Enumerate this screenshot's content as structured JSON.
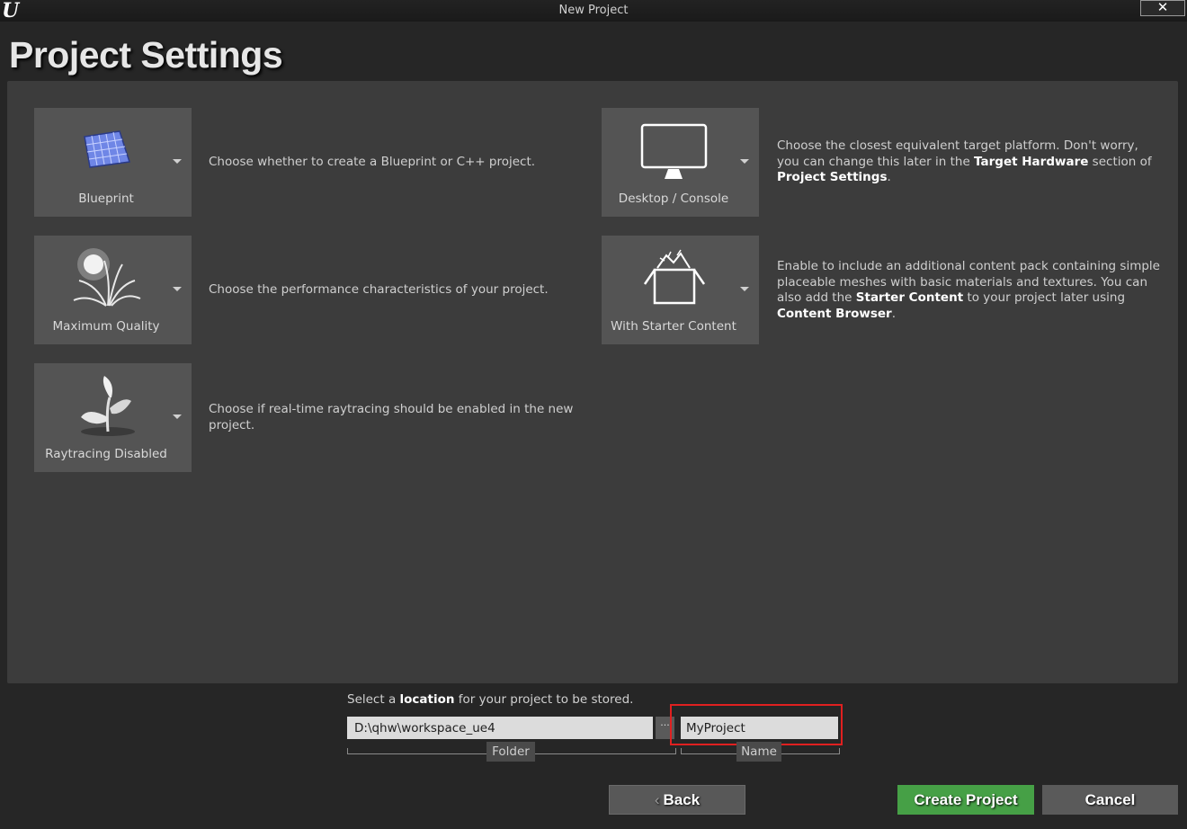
{
  "window": {
    "title": "New Project",
    "logo": "U",
    "close_glyph": "✕"
  },
  "page_title": "Project Settings",
  "tiles": [
    {
      "label": "Blueprint",
      "icon": "blueprint-icon",
      "description": "Choose whether to create a Blueprint or C++ project."
    },
    {
      "label": "Maximum Quality",
      "icon": "quality-plant-icon",
      "description": "Choose the performance characteristics of your project."
    },
    {
      "label": "Raytracing Disabled",
      "icon": "raytracing-leaf-icon",
      "description": "Choose if real-time raytracing should be enabled in the new project."
    },
    {
      "label": "Desktop / Console",
      "icon": "monitor-icon",
      "description_parts": [
        "Choose the closest equivalent target platform. Don't worry, you can change this later in the ",
        "Target Hardware",
        " section of ",
        "Project Settings",
        "."
      ]
    },
    {
      "label": "With Starter Content",
      "icon": "starter-content-box-icon",
      "description_parts": [
        "Enable to include an additional content pack containing simple placeable meshes with basic materials and textures. You can also add the ",
        "Starter Content",
        " to your project later using ",
        "Content Browser",
        "."
      ]
    }
  ],
  "location": {
    "label_pre": "Select a ",
    "label_bold": "location",
    "label_post": " for your project to be stored.",
    "folder_value": "D:\\qhw\\workspace_ue4",
    "browse_glyph": "···",
    "folder_caption": "Folder",
    "name_value": "MyProject",
    "name_caption": "Name"
  },
  "buttons": {
    "back": "Back",
    "back_arrow": "‹",
    "create": "Create Project",
    "cancel": "Cancel"
  },
  "colors": {
    "panel": "#3c3c3c",
    "tile": "#545454",
    "create_button": "#46a046",
    "highlight": "#e02020"
  }
}
